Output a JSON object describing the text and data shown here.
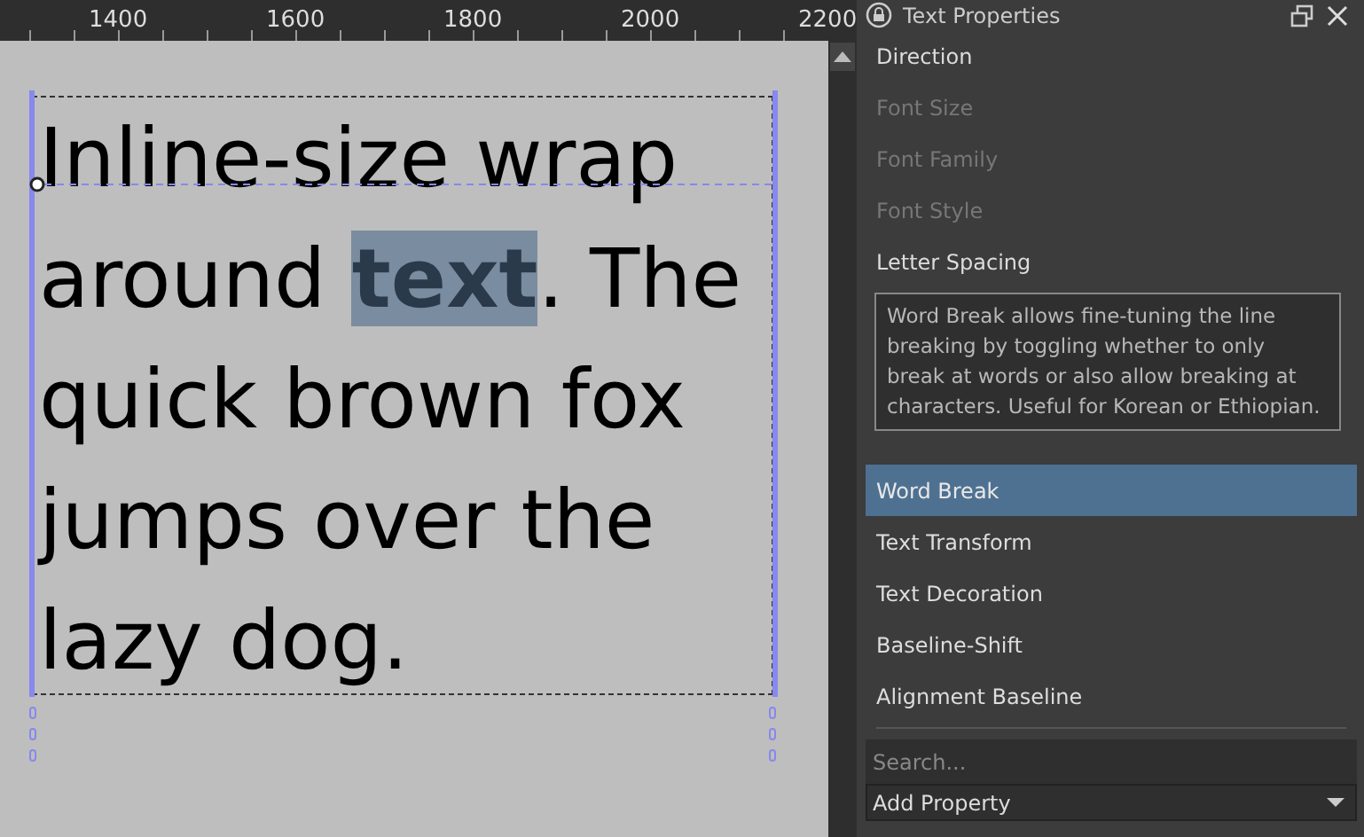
{
  "ruler": {
    "labels": [
      "1400",
      "1600",
      "1800",
      "2000",
      "2200"
    ]
  },
  "canvas": {
    "lines": [
      "Inline-size wrap",
      "around **text**. The",
      "quick brown fox",
      "jumps over the",
      "lazy dog."
    ]
  },
  "panel": {
    "title": "Text Properties",
    "items": [
      {
        "label": "Direction",
        "disabled": false,
        "selected": false
      },
      {
        "label": "Font Size",
        "disabled": true,
        "selected": false
      },
      {
        "label": "Font Family",
        "disabled": true,
        "selected": false
      },
      {
        "label": "Font Style",
        "disabled": true,
        "selected": false
      },
      {
        "label": "Letter Spacing",
        "disabled": false,
        "selected": false
      },
      {
        "label": "Word Break",
        "disabled": false,
        "selected": true
      },
      {
        "label": "Text Transform",
        "disabled": false,
        "selected": false
      },
      {
        "label": "Text Decoration",
        "disabled": false,
        "selected": false
      },
      {
        "label": "Baseline-Shift",
        "disabled": false,
        "selected": false
      },
      {
        "label": "Alignment Baseline",
        "disabled": false,
        "selected": false
      }
    ],
    "tooltip": "Word Break allows fine-tuning the line breaking by toggling whether to only break at words or also allow breaking at characters. Useful for Korean or Ethiopian.",
    "search": {
      "placeholder": "Search..."
    },
    "add_property": "Add Property"
  }
}
